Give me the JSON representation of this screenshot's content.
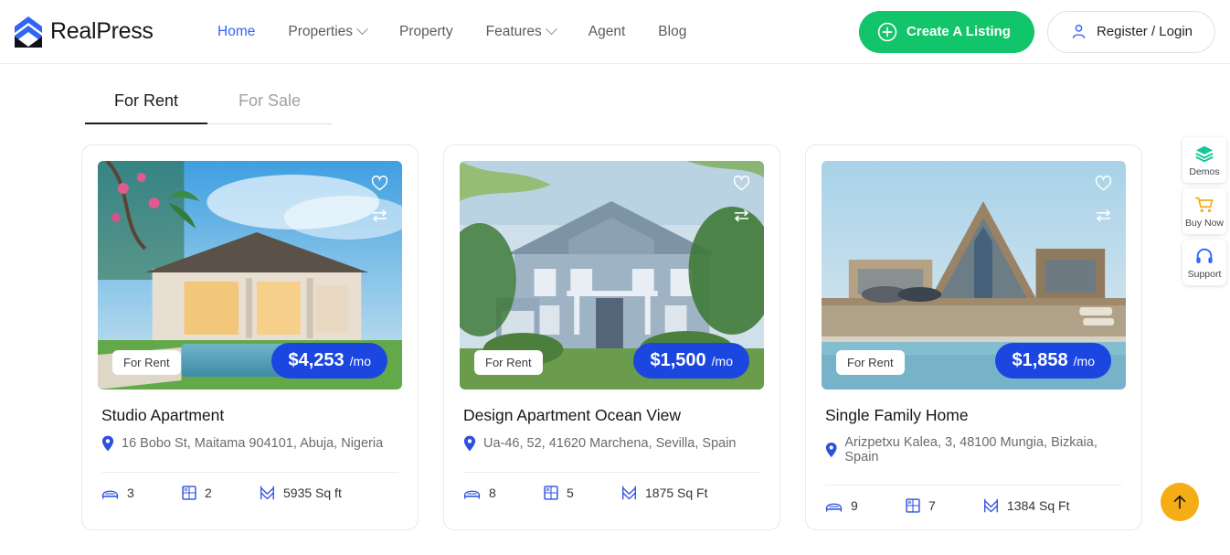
{
  "brand": {
    "name": "RealPress",
    "logo_icon": "chevron-stack-logo",
    "logo_colors": [
      "#2f66f5",
      "#111118"
    ]
  },
  "nav": {
    "items": [
      {
        "label": "Home",
        "active": true,
        "has_dropdown": false
      },
      {
        "label": "Properties",
        "active": false,
        "has_dropdown": true
      },
      {
        "label": "Property",
        "active": false,
        "has_dropdown": false
      },
      {
        "label": "Features",
        "active": false,
        "has_dropdown": true
      },
      {
        "label": "Agent",
        "active": false,
        "has_dropdown": false
      },
      {
        "label": "Blog",
        "active": false,
        "has_dropdown": false
      }
    ]
  },
  "header_actions": {
    "create_listing_label": "Create A Listing",
    "create_listing_icon": "plus-circle-icon",
    "create_listing_color": "#12c46a",
    "login_label": "Register / Login",
    "login_icon": "user-icon",
    "login_icon_color": "#2f66f5"
  },
  "tabs": [
    {
      "label": "For Rent",
      "active": true
    },
    {
      "label": "For Sale",
      "active": false
    }
  ],
  "listings": [
    {
      "status_badge": "For Rent",
      "price": "$4,253",
      "price_unit": "/mo",
      "title": "Studio Apartment",
      "address": "16 Bobo St, Maitama 904101, Abuja, Nigeria",
      "beds": "3",
      "baths": "2",
      "area": "5935 Sq ft",
      "image_alt": "tropical-villa-with-pool"
    },
    {
      "status_badge": "For Rent",
      "price": "$1,500",
      "price_unit": "/mo",
      "title": "Design Apartment Ocean View",
      "address": "Ua-46, 52, 41620 Marchena, Sevilla, Spain",
      "beds": "8",
      "baths": "5",
      "area": "1875 Sq Ft",
      "image_alt": "blue-colonial-house-with-trees"
    },
    {
      "status_badge": "For Rent",
      "price": "$1,858",
      "price_unit": "/mo",
      "title": "Single Family Home",
      "address": "Arizpetxu Kalea, 3, 48100 Mungia, Bizkaia, Spain",
      "beds": "9",
      "baths": "7",
      "area": "1384 Sq Ft",
      "image_alt": "modern-a-frame-house-with-pool"
    }
  ],
  "card_icons": {
    "favorite": "heart-icon",
    "compare": "compare-arrows-icon",
    "location": "map-pin-icon",
    "bed": "bed-icon",
    "bath": "bath-window-icon",
    "area": "area-size-icon",
    "accent_color": "#2f4fe0"
  },
  "side_widgets": [
    {
      "label": "Demos",
      "icon": "layers-icon",
      "color": "#16c79a"
    },
    {
      "label": "Buy Now",
      "icon": "shopping-cart-icon",
      "color": "#f5ad15"
    },
    {
      "label": "Support",
      "icon": "headset-icon",
      "color": "#2f66f5"
    }
  ],
  "scroll_to_top": {
    "icon": "arrow-up-icon",
    "color": "#f5ad15"
  },
  "price_badge_color": "#1b47e0"
}
